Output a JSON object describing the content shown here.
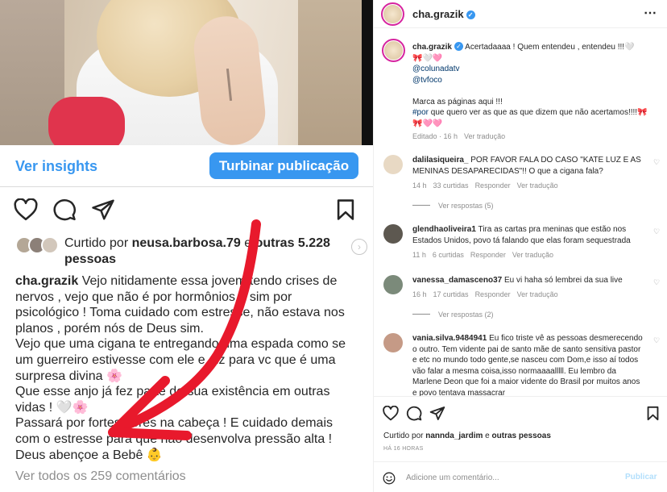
{
  "left": {
    "insights_label": "Ver insights",
    "boost_label": "Turbinar publicação",
    "liked_prefix": "Curtido por ",
    "liked_user": "neusa.barbosa.79",
    "liked_suffix": " e ",
    "liked_others": "outras 5.228 pessoas",
    "caption_user": "cha.grazik",
    "caption_paragraphs": [
      " Vejo nitidamente essa jovem tendo crises de nervos , vejo que não é por hormônios e sim por psicológico ! Toma cuidado com estresse, não estava nos planos , porém nós de Deus sim.",
      "Vejo que uma cigana te entregando uma espada como se um guerreiro estivesse com ele e diz para vc que é uma surpresa divina 🌸",
      "Que esse anjo já fez parte de sua existência em outras vidas ! 🤍🌸",
      "Passará por fortes dores na cabeça ! E cuidado demais com o estresse para que não desenvolva pressão alta !",
      "Deus abençoe a Bebê 👶"
    ],
    "view_all": "Ver todos os 259 comentários"
  },
  "right": {
    "username": "cha.grazik",
    "more_icon": "⋯",
    "caption_user": "cha.grazik",
    "caption_lines": [
      " Acertadaaaa ! Quem entendeu , entendeu !!!🤍",
      "🎀🤍🩷"
    ],
    "caption_mentions": [
      "@colunadatv",
      "@tvfoco"
    ],
    "caption_body": "Marca as páginas aqui !!!",
    "caption_hashtag": "#por",
    "caption_tail": " que quero ver as que as que dizem que não acertamos!!!!🎀🎀🩷🩷",
    "caption_meta": {
      "edited": "Editado · 16 h",
      "translate": "Ver tradução"
    },
    "comments": [
      {
        "user": "dalilasiqueira_",
        "text": " POR FAVOR FALA DO CASO \"KATE LUZ E AS MENINAS DESAPARECIDAS\"!! O que a cigana fala?",
        "time": "14 h",
        "likes": "33 curtidas",
        "reply": "Responder",
        "translate": "Ver tradução",
        "replies": "Ver respostas (5)",
        "color": "#e8d9c4"
      },
      {
        "user": "glendhaoliveira1",
        "text": " Tira as cartas pra meninas que estão nos Estados Unidos, povo tá falando que elas foram sequestrada",
        "time": "11 h",
        "likes": "6 curtidas",
        "reply": "Responder",
        "translate": "Ver tradução",
        "replies": "",
        "color": "#5d5850"
      },
      {
        "user": "vanessa_damasceno37",
        "text": " Eu vi haha só lembrei da sua live",
        "time": "16 h",
        "likes": "17 curtidas",
        "reply": "Responder",
        "translate": "Ver tradução",
        "replies": "Ver respostas (2)",
        "color": "#7b8a7a"
      },
      {
        "user": "vania.silva.9484941",
        "text": " Eu fico triste vê as pessoas desmerecendo o outro. Tem vidente pai de santo mãe de santo sensitiva pastor e etc no mundo todo gente,se nasceu com Dom,e isso aí todos vão falar a mesma coisa,isso normaaaalllll. Eu lembro da Marlene Deon que foi a maior vidente do Brasil por muitos anos e povo tentava massacrar",
        "time": "",
        "likes": "",
        "reply": "",
        "translate": "",
        "replies": "",
        "color": "#c59a86"
      }
    ],
    "liked_prefix": "Curtido por ",
    "liked_user": "nannda_jardim",
    "liked_suffix": " e ",
    "liked_others": "outras pessoas",
    "time_ago": "HÁ 16 HORAS",
    "comment_placeholder": "Adicione um comentário...",
    "publish_label": "Publicar"
  },
  "icons": [
    "heart-icon",
    "comment-icon",
    "share-icon",
    "bookmark-icon",
    "emoji-icon",
    "more-icon",
    "verified-icon"
  ],
  "colors": {
    "accent": "#3897f0",
    "arrow": "#e8192c",
    "muted": "#8e8e8e",
    "link": "#00376b"
  }
}
